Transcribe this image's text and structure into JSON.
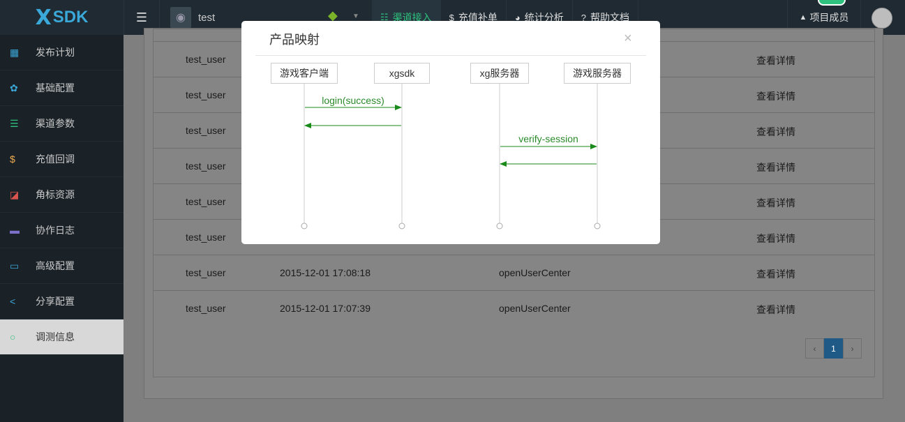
{
  "brand": {
    "logo_mark": "X",
    "logo_text": "SDK"
  },
  "header": {
    "menu_icon": "☰",
    "project_name": "test",
    "platform_icon": "android-icon",
    "nav": [
      {
        "icon": "☷",
        "label": "渠道接入",
        "active": true
      },
      {
        "icon": "$",
        "label": "充值补单",
        "active": false
      },
      {
        "icon": "◕",
        "label": "统计分析",
        "active": false
      },
      {
        "icon": "?",
        "label": "帮助文档",
        "active": false
      }
    ],
    "members_icon": "👥",
    "members_label": "项目成员"
  },
  "sidebar": {
    "items": [
      {
        "icon": "▦",
        "label": "发布计划",
        "color": "#3aa8d8"
      },
      {
        "icon": "✿",
        "label": "基础配置",
        "color": "#3aa8d8"
      },
      {
        "icon": "☰",
        "label": "渠道参数",
        "color": "#2ec27e"
      },
      {
        "icon": "$",
        "label": "充值回调",
        "color": "#f0ad4e"
      },
      {
        "icon": "◪",
        "label": "角标资源",
        "color": "#d9534f"
      },
      {
        "icon": "▬",
        "label": "协作日志",
        "color": "#7b6fc9"
      },
      {
        "icon": "▭",
        "label": "高级配置",
        "color": "#3aa8d8"
      },
      {
        "icon": "<",
        "label": "分享配置",
        "color": "#3aa8d8"
      },
      {
        "icon": "○",
        "label": "调测信息",
        "color": "#2ec27e",
        "active": true
      }
    ]
  },
  "table": {
    "rows": [
      {
        "user": "test_user",
        "time": "",
        "action": "",
        "link": "查看详情"
      },
      {
        "user": "test_user",
        "time": "",
        "action": "",
        "link": "查看详情"
      },
      {
        "user": "test_user",
        "time": "",
        "action": "",
        "link": "查看详情"
      },
      {
        "user": "test_user",
        "time": "",
        "action": "",
        "link": "查看详情"
      },
      {
        "user": "test_user",
        "time": "",
        "action": "",
        "link": "查看详情"
      },
      {
        "user": "test_user",
        "time": "",
        "action": "",
        "link": "查看详情"
      },
      {
        "user": "test_user",
        "time": "2015-12-01 17:08:18",
        "action": "openUserCenter",
        "link": "查看详情"
      },
      {
        "user": "test_user",
        "time": "2015-12-01 17:07:39",
        "action": "openUserCenter",
        "link": "查看详情"
      }
    ]
  },
  "pagination": {
    "prev": "‹",
    "current": "1",
    "next": "›"
  },
  "modal": {
    "title": "产品映射",
    "close": "×",
    "actors": [
      "游戏客户端",
      "xgsdk",
      "xg服务器",
      "游戏服务器"
    ],
    "messages": [
      {
        "label": "login(success)",
        "from": 0,
        "to": 1
      },
      {
        "label": "",
        "from": 1,
        "to": 0
      },
      {
        "label": "verify-session",
        "from": 2,
        "to": 3
      },
      {
        "label": "",
        "from": 3,
        "to": 2
      }
    ],
    "arrow_color": "#1a8a1a"
  }
}
